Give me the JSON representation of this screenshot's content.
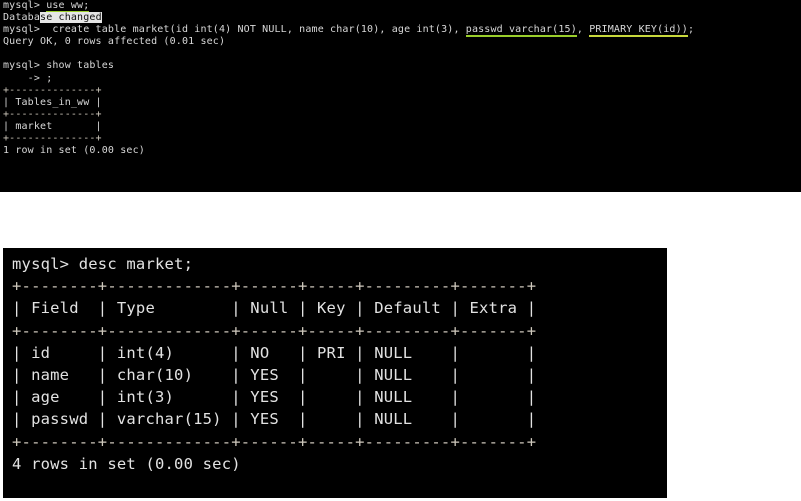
{
  "meta": {
    "app": "mysql-client-terminal",
    "background_color": "#ffffff",
    "terminal_background": "#000000",
    "terminal_foreground": "#d8d8d8",
    "highlight_underline_green": "#9ace2b",
    "highlight_underline_yellow": "#c8d83c",
    "selection_highlight": "#e6e6e6"
  },
  "terminal_top": {
    "lines": [
      {
        "id": "t1-l1",
        "segments": [
          {
            "text": "mysql> "
          },
          {
            "text": "use ww;",
            "style": "ul-green"
          }
        ]
      },
      {
        "id": "t1-l2",
        "segments": [
          {
            "text": "Databa"
          },
          {
            "text": "se changed",
            "style": "sel-hi"
          }
        ]
      },
      {
        "id": "t1-l3",
        "segments": [
          {
            "text": "mysql>  create table market(id int(4) NOT NULL, name char(10), age int(3), "
          },
          {
            "text": "passwd varchar(15)",
            "style": "ul-green"
          },
          {
            "text": ", "
          },
          {
            "text": "PRIMARY KEY(id))",
            "style": "ul-yellow"
          },
          {
            "text": ";"
          }
        ]
      },
      {
        "id": "t1-l4",
        "segments": [
          {
            "text": "Query OK, 0 rows affected (0.01 sec)"
          }
        ]
      },
      {
        "id": "t1-l5",
        "segments": [
          {
            "text": ""
          }
        ]
      },
      {
        "id": "t1-l6",
        "segments": [
          {
            "text": "mysql> show tables"
          }
        ]
      },
      {
        "id": "t1-l7",
        "segments": [
          {
            "text": "    -> ;"
          }
        ]
      },
      {
        "id": "t1-l8",
        "segments": [
          {
            "text": "+--------------+",
            "style": "rule"
          }
        ]
      },
      {
        "id": "t1-l9",
        "segments": [
          {
            "text": "| Tables_in_ww |"
          }
        ]
      },
      {
        "id": "t1-l10",
        "segments": [
          {
            "text": "+--------------+",
            "style": "rule"
          }
        ]
      },
      {
        "id": "t1-l11",
        "segments": [
          {
            "text": "| market       |"
          }
        ]
      },
      {
        "id": "t1-l12",
        "segments": [
          {
            "text": "+--------------+",
            "style": "rule"
          }
        ]
      },
      {
        "id": "t1-l13",
        "segments": [
          {
            "text": "1 row in set (0.00 sec)"
          }
        ]
      }
    ]
  },
  "terminal_bottom": {
    "lines": [
      {
        "id": "t2-l1",
        "segments": [
          {
            "text": "mysql> desc market;"
          }
        ]
      },
      {
        "id": "t2-l2",
        "segments": [
          {
            "text": "+--------+-------------+------+-----+---------+-------+",
            "style": "rule"
          }
        ]
      },
      {
        "id": "t2-l3",
        "segments": [
          {
            "text": "| Field  | Type        | Null | Key | Default | Extra |"
          }
        ]
      },
      {
        "id": "t2-l4",
        "segments": [
          {
            "text": "+--------+-------------+------+-----+---------+-------+",
            "style": "rule"
          }
        ]
      },
      {
        "id": "t2-l5",
        "segments": [
          {
            "text": "| id     | int(4)      | NO   | PRI | NULL    |       |"
          }
        ]
      },
      {
        "id": "t2-l6",
        "segments": [
          {
            "text": "| name   | char(10)    | YES  |     | NULL    |       |"
          }
        ]
      },
      {
        "id": "t2-l7",
        "segments": [
          {
            "text": "| age    | int(3)      | YES  |     | NULL    |       |"
          }
        ]
      },
      {
        "id": "t2-l8",
        "segments": [
          {
            "text": "| passwd | varchar(15) | YES  |     | NULL    |       |"
          }
        ]
      },
      {
        "id": "t2-l9",
        "segments": [
          {
            "text": "+--------+-------------+------+-----+---------+-------+",
            "style": "rule"
          }
        ]
      },
      {
        "id": "t2-l10",
        "segments": [
          {
            "text": "4 rows in set (0.00 sec)"
          }
        ]
      }
    ],
    "table": {
      "columns": [
        "Field",
        "Type",
        "Null",
        "Key",
        "Default",
        "Extra"
      ],
      "rows": [
        [
          "id",
          "int(4)",
          "NO",
          "PRI",
          "NULL",
          ""
        ],
        [
          "name",
          "char(10)",
          "YES",
          "",
          "NULL",
          ""
        ],
        [
          "age",
          "int(3)",
          "YES",
          "",
          "NULL",
          ""
        ],
        [
          "passwd",
          "varchar(15)",
          "YES",
          "",
          "NULL",
          ""
        ]
      ],
      "footer": "4 rows in set (0.00 sec)"
    }
  }
}
